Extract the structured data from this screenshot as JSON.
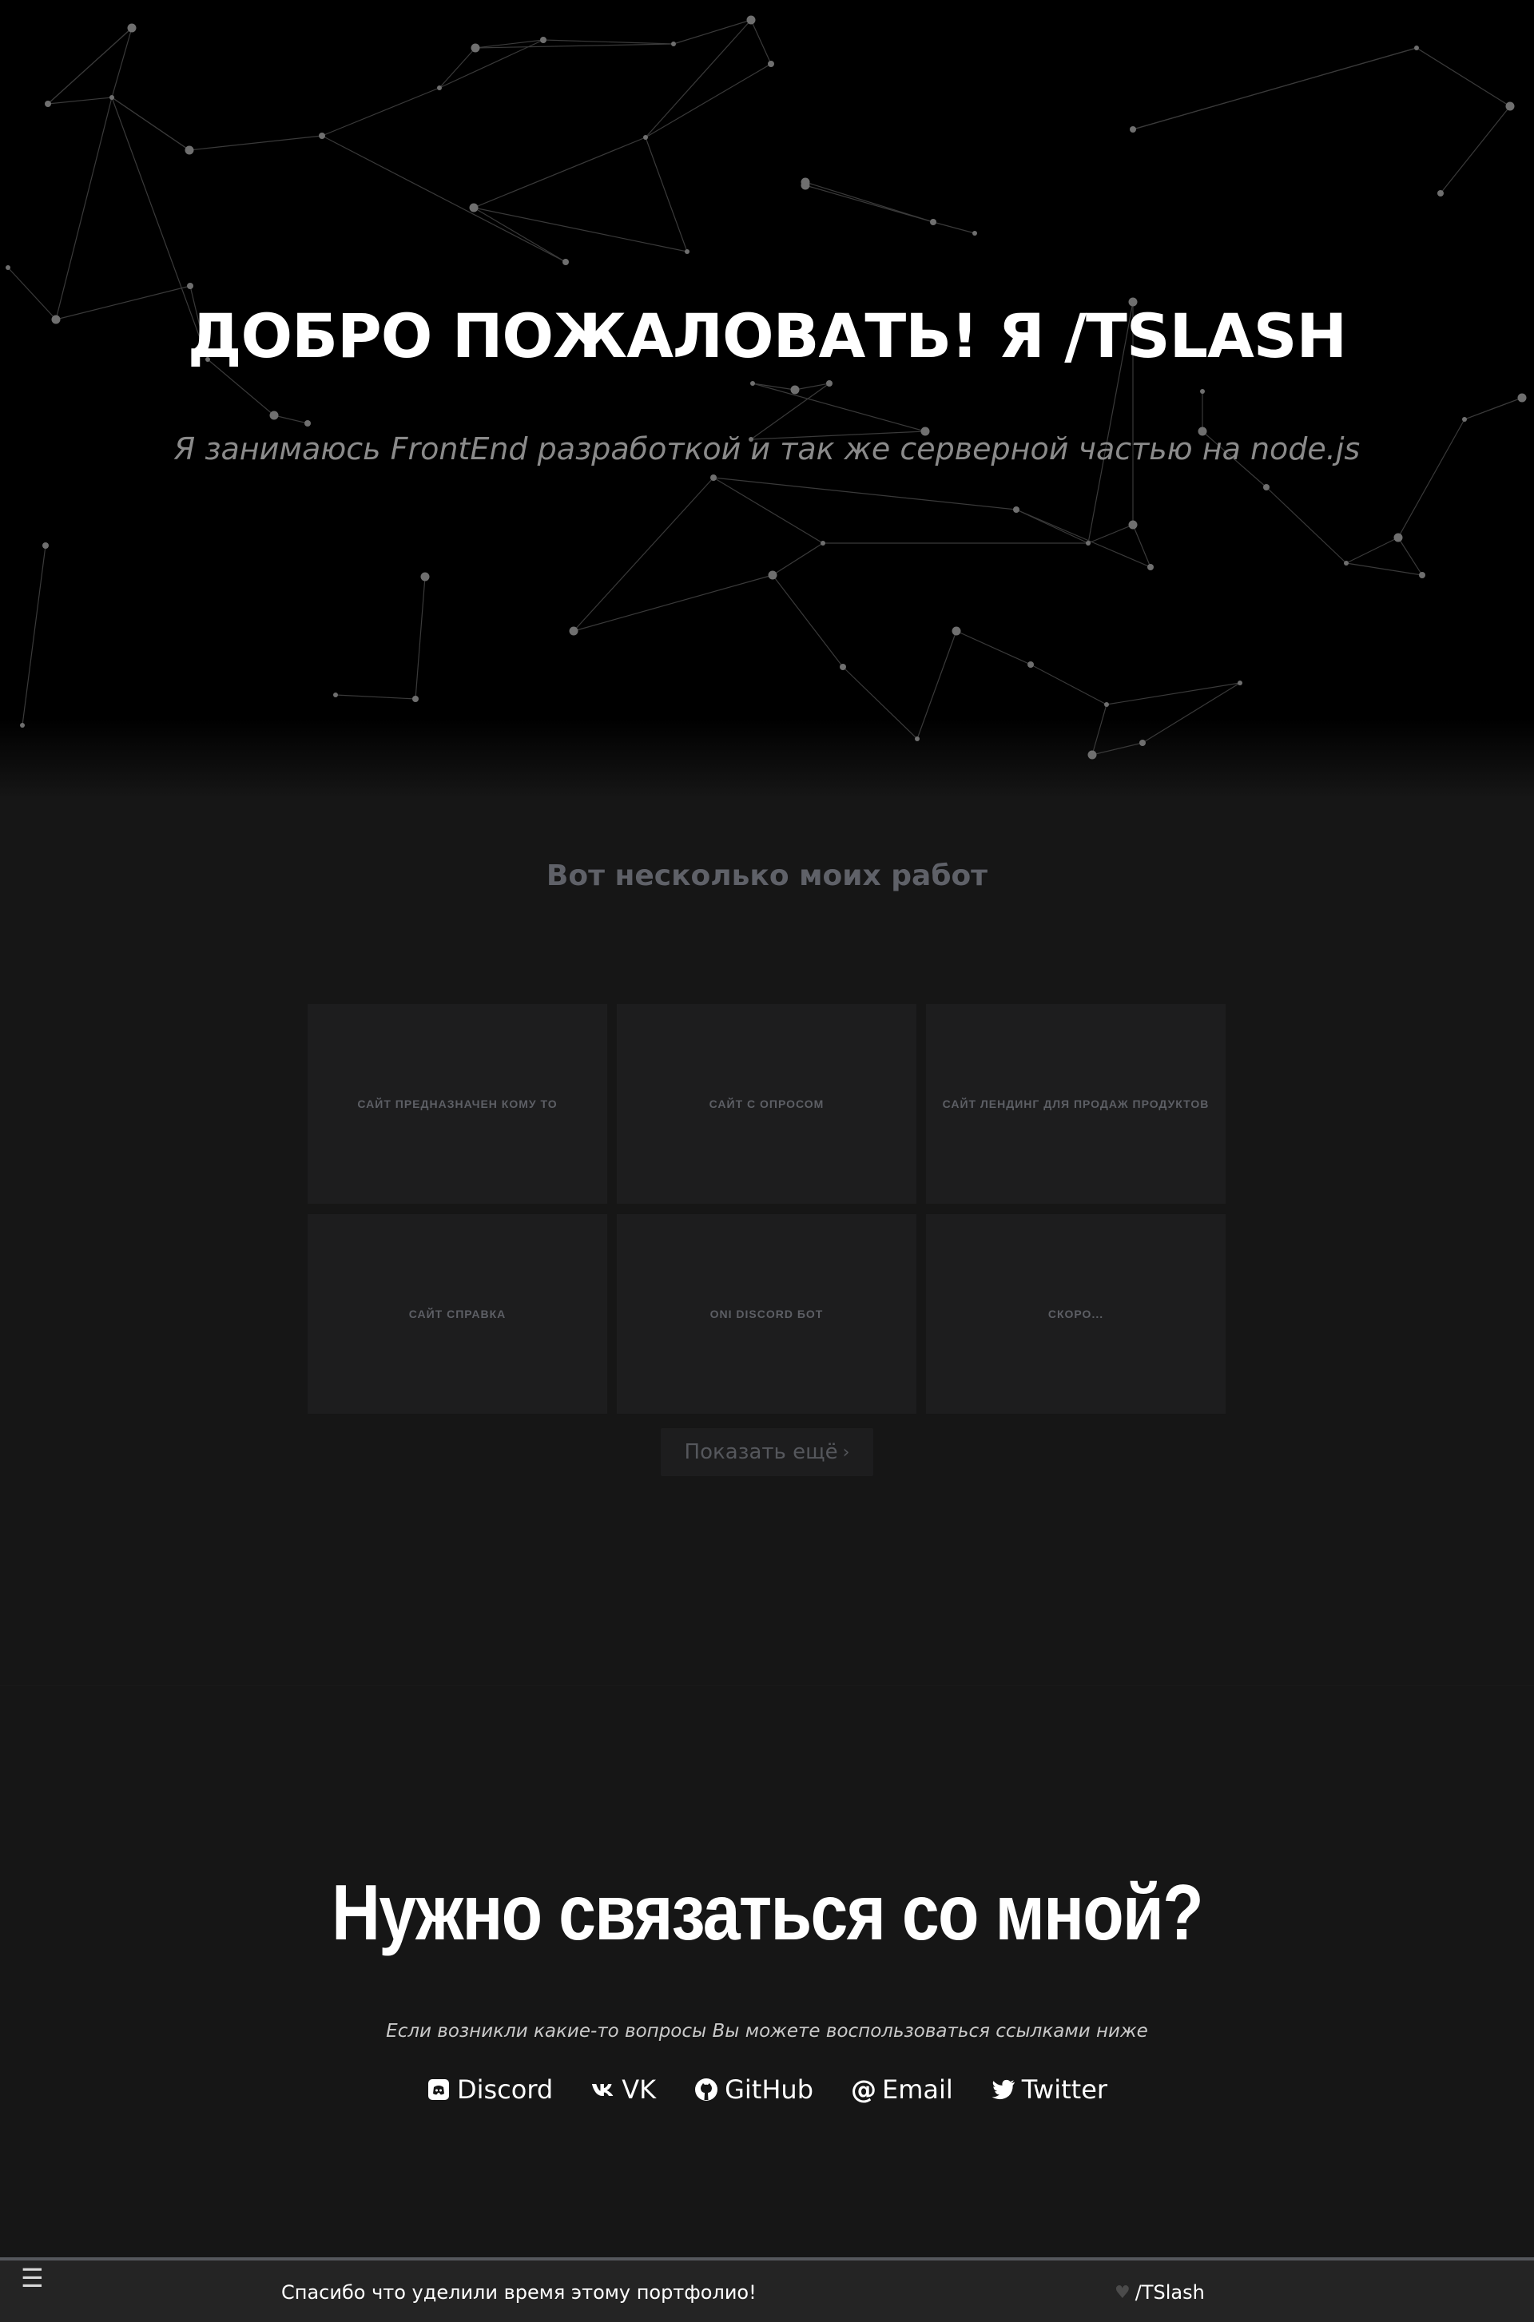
{
  "hero": {
    "title": "ДОБРО ПОЖАЛОВАТЬ! Я /TSLASH",
    "subtitle": "Я занимаюсь FrontEnd разработкой и так же серверной частью на node.js"
  },
  "works": {
    "title": "Вот несколько моих работ",
    "cards": [
      {
        "label": "САЙТ ПРЕДНАЗНАЧЕН КОМУ ТО"
      },
      {
        "label": "САЙТ С ОПРОСОМ"
      },
      {
        "label": "САЙТ ЛЕНДИНГ ДЛЯ ПРОДАЖ ПРОДУКТОВ"
      },
      {
        "label": "САЙТ СПРАВКА"
      },
      {
        "label": "ONI DISCORD БОТ"
      },
      {
        "label": "СКОРО..."
      }
    ],
    "more_label": "Показать ещё",
    "more_icon": "chevron-right-icon"
  },
  "contact": {
    "title": "Нужно связаться со мной?",
    "subtitle": "Если возникли какие-то вопросы Вы можете воспользоваться ссылками ниже",
    "links": [
      {
        "label": "Discord",
        "icon": "discord-icon"
      },
      {
        "label": "VK",
        "icon": "vk-icon"
      },
      {
        "label": "GitHub",
        "icon": "github-icon"
      },
      {
        "label": "Email",
        "icon": "at-icon"
      },
      {
        "label": "Twitter",
        "icon": "twitter-icon"
      }
    ]
  },
  "footer": {
    "menu_icon": "menu-icon",
    "text": "Спасибо что уделили время этому портфолио!",
    "signature": "/TSlash",
    "heart_icon": "heart-icon"
  },
  "colors": {
    "background": "#161616",
    "hero_background": "#000000",
    "card_background": "#1d1d1e",
    "muted_text": "#5f6168",
    "footer_background": "#242424"
  }
}
